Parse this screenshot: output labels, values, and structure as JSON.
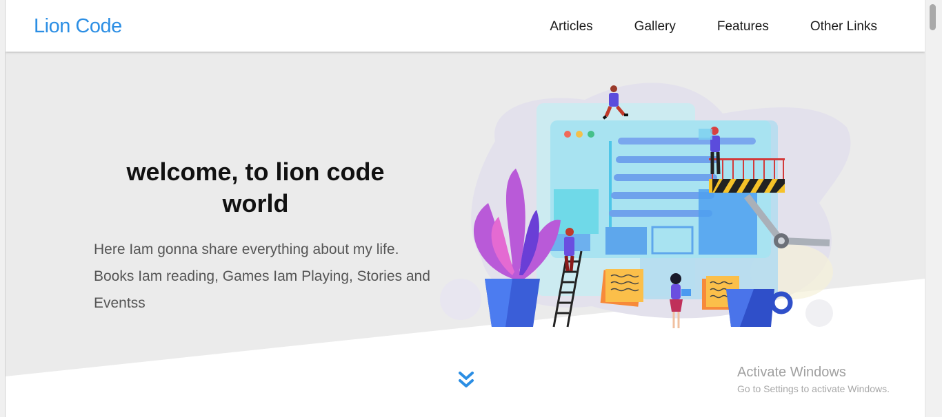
{
  "brand": "Lion Code",
  "nav": [
    "Articles",
    "Gallery",
    "Features",
    "Other Links"
  ],
  "hero": {
    "title": "welcome, to lion code world",
    "description": "Here Iam gonna share everything about my life. Books Iam reading, Games Iam Playing, Stories and Eventss"
  },
  "watermark": {
    "title": "Activate Windows",
    "subtitle": "Go to Settings to activate Windows."
  },
  "colors": {
    "brand": "#2b8ee4",
    "hero_bg": "#ebebeb",
    "chevron": "#2b8ee4"
  },
  "icons": {
    "scroll_down": "double-chevron-down-icon"
  }
}
